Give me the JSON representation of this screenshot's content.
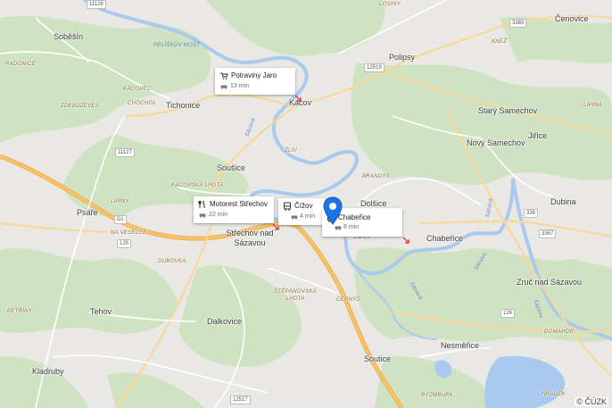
{
  "places": {
    "sobesin": "Soběšín",
    "cenovice": "Čenovice",
    "polipsy": "Polipsy",
    "tichonice": "Tichonice",
    "kacov": "Kácov",
    "stary_samechov": "Starý Samechov",
    "novy_samechov": "Nový Samechov",
    "jirice": "Jiřice",
    "sousice": "Soušice",
    "psare": "Psáře",
    "strechov": "Střechov nad Sázavou",
    "dolsice": "Dolšice",
    "chabenice_village": "Chabeřice",
    "dubina": "Dubina",
    "zruc": "Zruč nad Sázavou",
    "tehov": "Tehov",
    "dalkovice": "Dalkovice",
    "nesmerice": "Nesměřice",
    "soutice": "Soutice",
    "kladruby": "Kladruby"
  },
  "small_labels": {
    "losiny": "LOSINY",
    "radonice": "RADONICE",
    "kacovec": "KÁCOVEC",
    "chochol": "CHOCHOL",
    "zdebuzeves": "ZDEBUZEVES",
    "knez": "KNĚŽ",
    "lipina": "LIPINA",
    "zliv": "ZLIV",
    "brandys": "BRANDÝS",
    "kacovska_lhota": "KÁCOVSKÁ LHOTA",
    "lipiny": "LIPINY",
    "na_veselce": "NA VESELCE",
    "dubovka": "DUBOVKA",
    "stepanovska_lhota": "ŠTĚPÁNOVSKÁ LHOTA",
    "cizov_small": "ČÍŽOV",
    "petriny": "PETŘÍNY",
    "cerneves": "ČERNÝŠ",
    "domahor": "DOMAHOR",
    "hradek": "HRÁDEK",
    "ryzmburk": "RÝZMBURK"
  },
  "water_labels": {
    "pelisky_most": "PELÍŠKŮV MOST",
    "sazava1": "Sázava",
    "sazava2": "Sázava",
    "sazava3": "Sázava",
    "sazava4": "Sázava",
    "sazava5": "Sázava"
  },
  "road_shields": {
    "r11128": "11128",
    "r3365": "3365",
    "r12519": "12519",
    "r11127": "11127",
    "rD1": "D1",
    "r125": "125",
    "r336": "336",
    "r3367": "3367",
    "r126": "126",
    "r12517": "12517"
  },
  "cards": [
    {
      "title": "Potraviny Jaro",
      "time": "13 min",
      "icon": "shopping-cart-icon"
    },
    {
      "title": "Motorest Střechov",
      "time": "22 min",
      "icon": "restaurant-icon"
    },
    {
      "title": "Čížov",
      "time": "4 min",
      "icon": "bus-icon"
    },
    {
      "title": "Chabeřice",
      "time": "8 min",
      "icon": "bus-icon"
    }
  ],
  "copyright": "© ČÚZK",
  "colors": {
    "land": "#e9e8e4",
    "forest": "#cfe3c3",
    "water": "#a9c9ee",
    "highway": "#f6c26b",
    "road": "#ffffff",
    "pin": "#1a73e8"
  }
}
